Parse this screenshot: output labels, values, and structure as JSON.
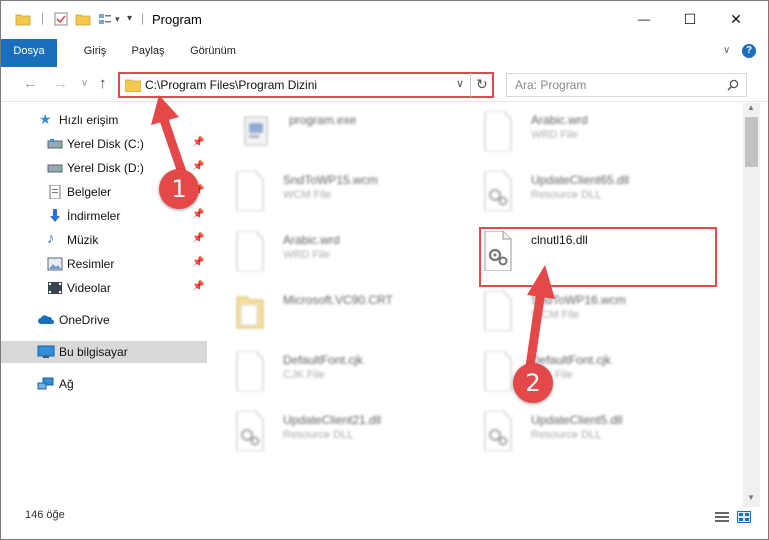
{
  "window": {
    "title": "Program",
    "controls": {
      "minimize": "—",
      "maximize": "☐",
      "close": "✕"
    }
  },
  "ribbon": {
    "tabs": [
      {
        "label": "Dosya"
      },
      {
        "label": "Giriş"
      },
      {
        "label": "Paylaş"
      },
      {
        "label": "Görünüm"
      }
    ],
    "help": "?"
  },
  "address": {
    "path": "C:\\Program Files\\Program Dizini",
    "search_placeholder": "Ara: Program"
  },
  "nav": {
    "items": [
      {
        "label": "Hızlı erişim",
        "icon": "star-icon",
        "pinned": false
      },
      {
        "label": "Yerel Disk (C:)",
        "icon": "drive-icon",
        "pinned": true
      },
      {
        "label": "Yerel Disk (D:)",
        "icon": "drive-icon",
        "pinned": true
      },
      {
        "label": "Belgeler",
        "icon": "document-icon",
        "pinned": true
      },
      {
        "label": "İndirmeler",
        "icon": "download-icon",
        "pinned": true
      },
      {
        "label": "Müzik",
        "icon": "music-icon",
        "pinned": true
      },
      {
        "label": "Resimler",
        "icon": "pictures-icon",
        "pinned": true
      },
      {
        "label": "Videolar",
        "icon": "video-icon",
        "pinned": true
      },
      {
        "label": "OneDrive",
        "icon": "cloud-icon",
        "pinned": false
      },
      {
        "label": "Bu bilgisayar",
        "icon": "computer-icon",
        "pinned": false
      },
      {
        "label": "Ağ",
        "icon": "network-icon",
        "pinned": false
      }
    ]
  },
  "files": [
    {
      "name": "program.exe",
      "type": "",
      "icon": "exe-icon"
    },
    {
      "name": "Arabic.wrd",
      "type": "WRD File",
      "icon": "file-icon"
    },
    {
      "name": "SndToWP15.wcm",
      "type": "WCM File",
      "icon": "file-icon"
    },
    {
      "name": "UpdateClient65.dll",
      "type": "Resource DLL",
      "icon": "dll-icon"
    },
    {
      "name": "Arabic.wrd",
      "type": "WRD File",
      "icon": "file-icon"
    },
    {
      "name": "clnutl16.dll",
      "type": "",
      "icon": "dll-icon"
    },
    {
      "name": "Microsoft.VC90.CRT",
      "type": "",
      "icon": "folder-icon"
    },
    {
      "name": "SndToWP16.wcm",
      "type": "WCM File",
      "icon": "file-icon"
    },
    {
      "name": "DefaultFont.cjk",
      "type": "CJK File",
      "icon": "file-icon"
    },
    {
      "name": "DefaultFont.cjk",
      "type": "CJK File",
      "icon": "file-icon"
    },
    {
      "name": "UpdateClient21.dll",
      "type": "Resource DLL",
      "icon": "dll-icon"
    },
    {
      "name": "UpdateClient5.dll",
      "type": "Resource DLL",
      "icon": "dll-icon"
    }
  ],
  "status": {
    "count": "146 öğe"
  },
  "annotations": {
    "step1": "1",
    "step2": "2",
    "color": "#e54848"
  }
}
